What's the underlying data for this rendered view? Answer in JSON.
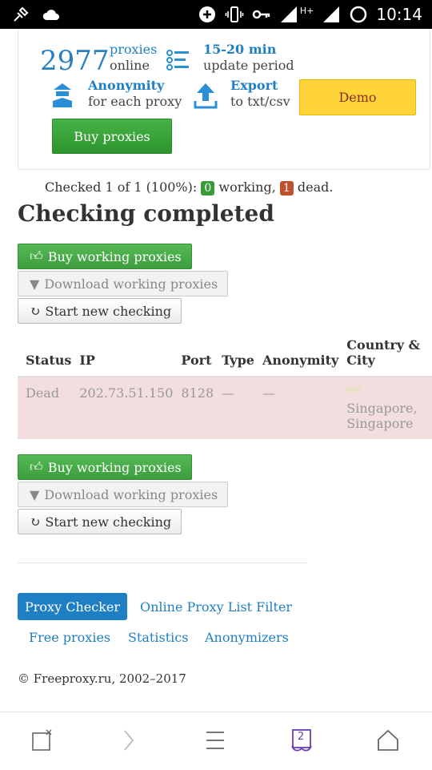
{
  "status_bar": {
    "time": "10:14",
    "network": "H+"
  },
  "promo": {
    "count": "2977",
    "count_label_1": "proxies",
    "count_label_2": "online",
    "update_label_1": "15-20 min",
    "update_label_2": "update period",
    "anon_label_1": "Anonymity",
    "anon_label_2": "for each proxy",
    "export_label_1": "Export",
    "export_label_2": "to txt/csv",
    "demo_label": "Demo",
    "buy_label": "Buy proxies"
  },
  "summary": {
    "prefix": "Checked 1 of 1 (100%):",
    "working_count": "0",
    "working_text": "working,",
    "dead_count": "1",
    "dead_text": "dead."
  },
  "heading": "Checking completed",
  "actions": {
    "buy_working": "Buy working proxies",
    "download_working": "Download working proxies",
    "start_new": "Start new checking"
  },
  "table": {
    "headers": [
      "Status",
      "IP",
      "Port",
      "Type",
      "Anonymity",
      "Country & City"
    ],
    "rows": [
      {
        "status": "Dead",
        "ip": "202.73.51.150",
        "port": "8128",
        "type": "—",
        "anonymity": "—",
        "country_city": "Singapore, Singapore"
      }
    ]
  },
  "nav": {
    "active": "Proxy Checker",
    "items": [
      "Online Proxy List Filter",
      "Free proxies",
      "Statistics",
      "Anonymizers"
    ]
  },
  "footer": "© Freeproxy.ru, 2002–2017",
  "bottom_bar": {
    "tab_count": "2"
  },
  "colors": {
    "link_blue": "#1f7fc4",
    "green": "#3aa53a",
    "demo_yellow": "#ffd43b",
    "dead_row": "#f2dede"
  }
}
